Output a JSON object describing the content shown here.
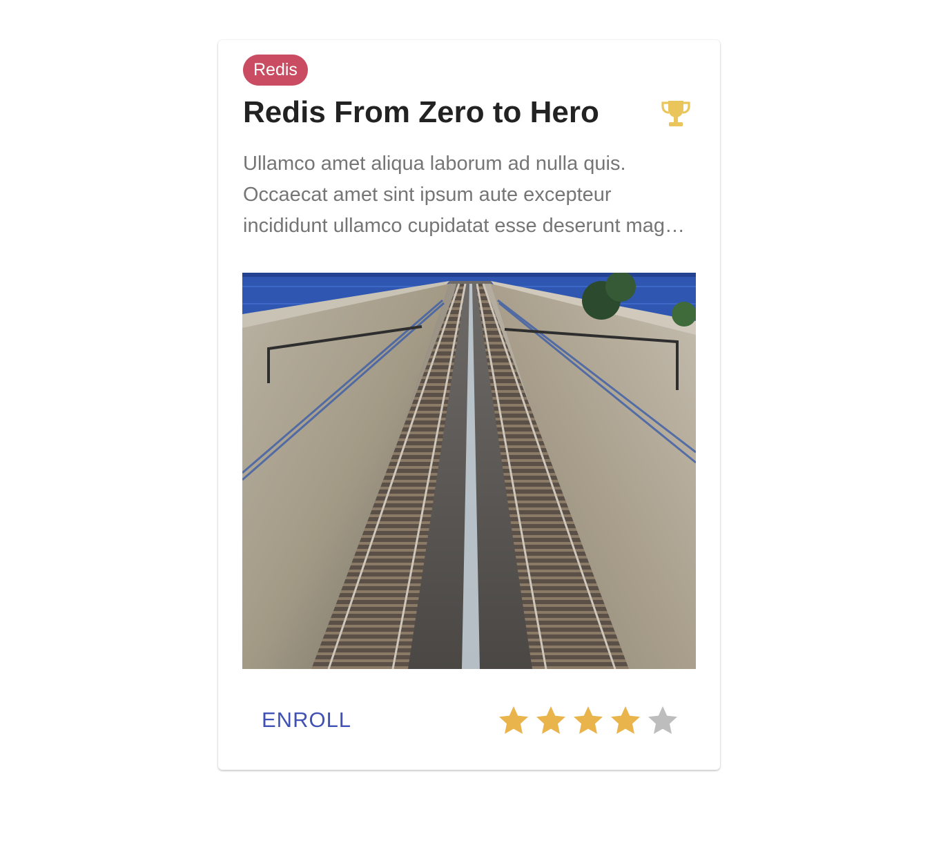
{
  "course": {
    "tag": "Redis",
    "title": "Redis From Zero to Hero",
    "description": "Ullamco amet aliqua laborum ad nulla quis. Occaecat amet sint ipsum aute excepteur incididunt ullamco cupidatat esse deserunt magna eiusmod.",
    "enroll_label": "ENROLL",
    "rating": 4,
    "rating_max": 5
  },
  "icons": {
    "award": "trophy-icon",
    "rating": "star-icon"
  },
  "colors": {
    "tag_background": "#C94C62",
    "trophy": "#E9C55B",
    "star_filled": "#E9B44C",
    "star_empty": "#BDBDBD",
    "enroll_text": "#3F51B5"
  }
}
